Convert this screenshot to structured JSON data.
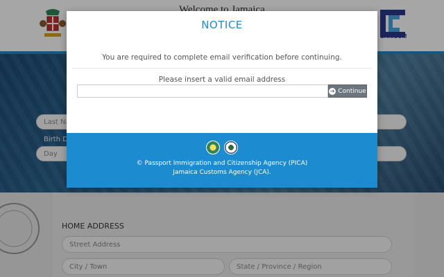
{
  "header": {
    "welcome": "Welcome to Jamaica",
    "caricom": "CARICOM"
  },
  "form": {
    "last_name_placeholder": "Last Name",
    "birth_date_label": "Birth Date",
    "day_placeholder": "Day",
    "home_address_title": "HOME ADDRESS",
    "street_placeholder": "Street Address",
    "city_placeholder": "City / Town",
    "state_placeholder": "State / Province / Region"
  },
  "modal": {
    "title": "NOTICE",
    "message": "You are required to complete email verification before continuing.",
    "email_label": "Please insert a valid email address",
    "email_value": "",
    "continue_label": "Continue",
    "footer_line1": "© Passport Immigration and Citizenship Agency (PICA)",
    "footer_line2": "Jamaica Customs Agency (JCA)."
  },
  "colors": {
    "accent": "#1c8bd0",
    "button": "#6c757d"
  }
}
